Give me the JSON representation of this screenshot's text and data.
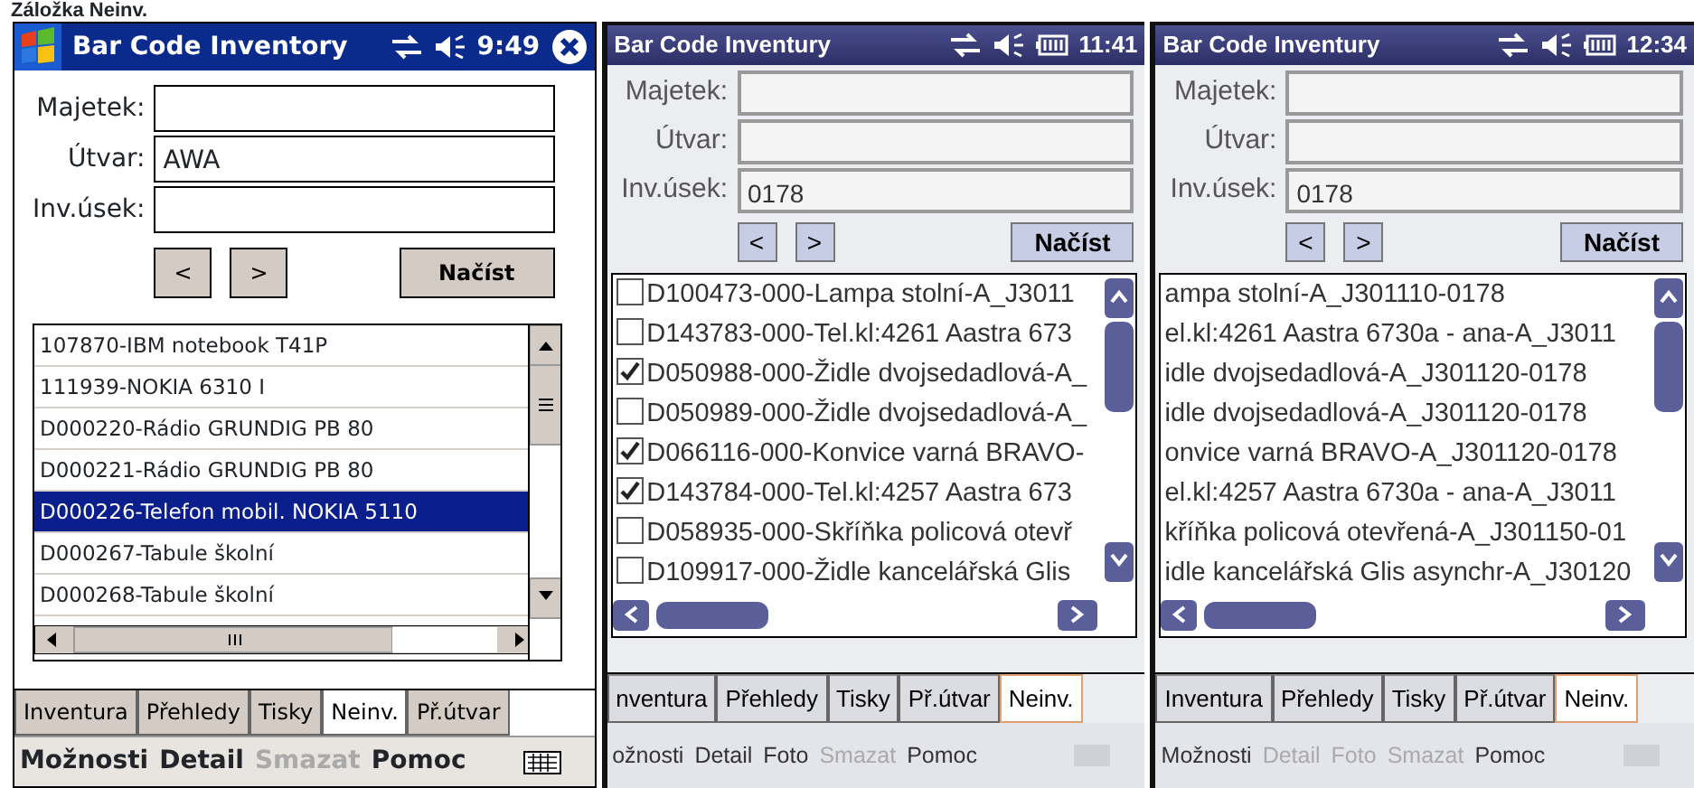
{
  "caption": "Záložka Neinv.",
  "screens": [
    {
      "kind": "classic",
      "title": "Bar Code Inventory",
      "time": "9:49",
      "fields": [
        {
          "label": "Majetek:"
        },
        {
          "label": "Útvar:",
          "value": "AWA"
        },
        {
          "label": "Inv.úsek:"
        }
      ],
      "nav_buttons": [
        "<",
        ">"
      ],
      "load_button": "Načíst",
      "list": {
        "kind": "plain",
        "items": [
          {
            "text": "107870-IBM notebook T41P",
            "selected": false
          },
          {
            "text": "111939-NOKIA 6310 I",
            "selected": false
          },
          {
            "text": "D000220-Rádio GRUNDIG PB 80",
            "selected": false
          },
          {
            "text": "D000221-Rádio GRUNDIG PB 80",
            "selected": false
          },
          {
            "text": "D000226-Telefon mobil. NOKIA 5110",
            "selected": true
          },
          {
            "text": "D000267-Tabule školní",
            "selected": false
          },
          {
            "text": "D000268-Tabule školní",
            "selected": false
          }
        ]
      },
      "tabs": [
        {
          "label": "Inventura",
          "selected": false
        },
        {
          "label": "Přehledy",
          "selected": false
        },
        {
          "label": "Tisky",
          "selected": false
        },
        {
          "label": "Neinv.",
          "selected": true
        },
        {
          "label": "Př.útvar",
          "selected": false
        }
      ],
      "menu": [
        {
          "label": "Možnosti",
          "disabled": false
        },
        {
          "label": "Detail",
          "disabled": false
        },
        {
          "label": "Smazat",
          "disabled": true
        },
        {
          "label": "Pomoc",
          "disabled": false
        }
      ]
    },
    {
      "kind": "photo",
      "title": "Bar Code Inventury",
      "time": "11:41",
      "fields": [
        {
          "label": "Majetek:"
        },
        {
          "label": "Útvar:"
        },
        {
          "label": "Inv.úsek:",
          "value": "0178"
        }
      ],
      "nav_buttons": [
        "<",
        ">"
      ],
      "load_button": "Načíst",
      "list": {
        "kind": "checkbox",
        "items": [
          {
            "text": "D100473-000-Lampa stolní-A_J3011",
            "checked": false
          },
          {
            "text": "D143783-000-Tel.kl:4261 Aastra 673",
            "checked": false
          },
          {
            "text": "D050988-000-Židle dvojsedadlová-A_",
            "checked": true
          },
          {
            "text": "D050989-000-Židle dvojsedadlová-A_",
            "checked": false
          },
          {
            "text": "D066116-000-Konvice varná BRAVO-",
            "checked": true
          },
          {
            "text": "D143784-000-Tel.kl:4257 Aastra 673",
            "checked": true
          },
          {
            "text": "D058935-000-Skříňka policová otevř",
            "checked": false
          },
          {
            "text": "D109917-000-Židle kancelářská Glis",
            "checked": false
          }
        ]
      },
      "tabs": [
        {
          "label": "nventura",
          "selected": false
        },
        {
          "label": "Přehledy",
          "selected": false
        },
        {
          "label": "Tisky",
          "selected": false
        },
        {
          "label": "Př.útvar",
          "selected": false
        },
        {
          "label": "Neinv.",
          "selected": true
        }
      ],
      "menu": [
        {
          "label": "ožnosti",
          "disabled": false
        },
        {
          "label": "Detail",
          "disabled": false
        },
        {
          "label": "Foto",
          "disabled": false
        },
        {
          "label": "Smazat",
          "disabled": true
        },
        {
          "label": "Pomoc",
          "disabled": false
        }
      ]
    },
    {
      "kind": "photo",
      "title": "Bar Code Inventury",
      "time": "12:34",
      "fields": [
        {
          "label": "Majetek:"
        },
        {
          "label": "Útvar:"
        },
        {
          "label": "Inv.úsek:",
          "value": "0178"
        }
      ],
      "nav_buttons": [
        "<",
        ">"
      ],
      "load_button": "Načíst",
      "list": {
        "kind": "plain",
        "items": [
          {
            "text": "ampa stolní-A_J301110-0178",
            "selected": false
          },
          {
            "text": "el.kl:4261 Aastra 6730a - ana-A_J3011",
            "selected": false
          },
          {
            "text": "idle dvojsedadlová-A_J301120-0178",
            "selected": false
          },
          {
            "text": "idle dvojsedadlová-A_J301120-0178",
            "selected": false
          },
          {
            "text": "onvice varná BRAVO-A_J301120-0178",
            "selected": false
          },
          {
            "text": "el.kl:4257 Aastra 6730a - ana-A_J3011",
            "selected": false
          },
          {
            "text": "kříňka policová otevřená-A_J301150-01",
            "selected": false
          },
          {
            "text": "idle kancelářská Glis asynchr-A_J30120",
            "selected": false
          }
        ]
      },
      "tabs": [
        {
          "label": "Inventura",
          "selected": false
        },
        {
          "label": "Přehledy",
          "selected": false
        },
        {
          "label": "Tisky",
          "selected": false
        },
        {
          "label": "Př.útvar",
          "selected": false
        },
        {
          "label": "Neinv.",
          "selected": true
        }
      ],
      "menu": [
        {
          "label": "Možnosti",
          "disabled": false
        },
        {
          "label": "Detail",
          "disabled": true
        },
        {
          "label": "Foto",
          "disabled": true
        },
        {
          "label": "Smazat",
          "disabled": true
        },
        {
          "label": "Pomoc",
          "disabled": false
        }
      ]
    }
  ]
}
